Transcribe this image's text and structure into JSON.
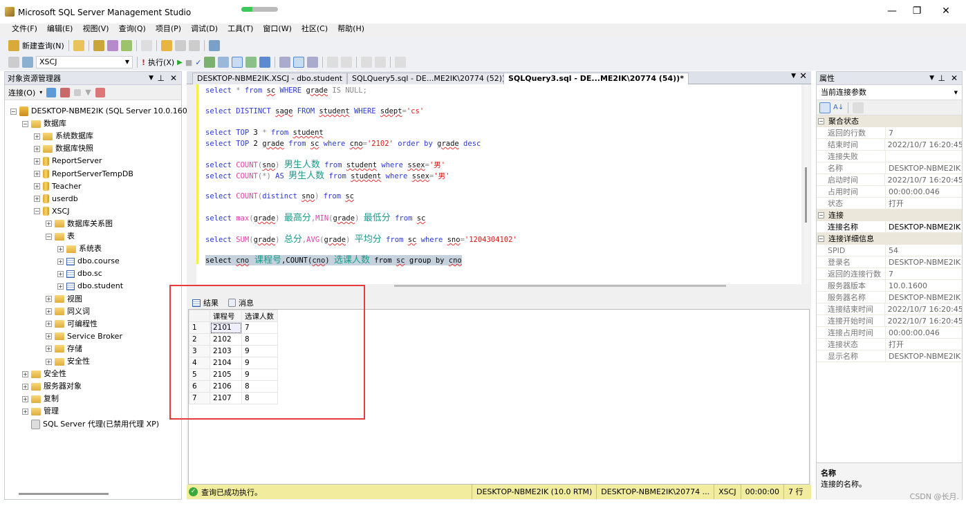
{
  "window": {
    "title": "Microsoft SQL Server Management Studio",
    "progress_percent": 30,
    "min": "—",
    "restore": "❐",
    "close": "✕"
  },
  "menu": [
    "文件(F)",
    "编辑(E)",
    "视图(V)",
    "查询(Q)",
    "项目(P)",
    "调试(D)",
    "工具(T)",
    "窗口(W)",
    "社区(C)",
    "帮助(H)"
  ],
  "toolbar1": {
    "new_query": "新建查询(N)"
  },
  "toolbar2": {
    "database": "XSCJ",
    "execute": "执行(X)"
  },
  "object_explorer": {
    "title": "对象资源管理器",
    "connect": "连接(O)",
    "items": [
      {
        "label": "DESKTOP-NBME2IK (SQL Server 10.0.1600",
        "icon": "server",
        "exp": "−",
        "level": 0
      },
      {
        "label": "数据库",
        "icon": "folder",
        "exp": "−",
        "level": 1
      },
      {
        "label": "系统数据库",
        "icon": "folder",
        "exp": "+",
        "level": 2
      },
      {
        "label": "数据库快照",
        "icon": "folder",
        "exp": "+",
        "level": 2
      },
      {
        "label": "ReportServer",
        "icon": "database",
        "exp": "+",
        "level": 2
      },
      {
        "label": "ReportServerTempDB",
        "icon": "database",
        "exp": "+",
        "level": 2
      },
      {
        "label": "Teacher",
        "icon": "database",
        "exp": "+",
        "level": 2
      },
      {
        "label": "userdb",
        "icon": "database",
        "exp": "+",
        "level": 2
      },
      {
        "label": "XSCJ",
        "icon": "database",
        "exp": "−",
        "level": 2
      },
      {
        "label": "数据库关系图",
        "icon": "folder",
        "exp": "+",
        "level": 3
      },
      {
        "label": "表",
        "icon": "folder",
        "exp": "−",
        "level": 3
      },
      {
        "label": "系统表",
        "icon": "folder",
        "exp": "+",
        "level": 4
      },
      {
        "label": "dbo.course",
        "icon": "table",
        "exp": "+",
        "level": 4
      },
      {
        "label": "dbo.sc",
        "icon": "table",
        "exp": "+",
        "level": 4
      },
      {
        "label": "dbo.student",
        "icon": "table",
        "exp": "+",
        "level": 4
      },
      {
        "label": "视图",
        "icon": "folder",
        "exp": "+",
        "level": 3
      },
      {
        "label": "同义词",
        "icon": "folder",
        "exp": "+",
        "level": 3
      },
      {
        "label": "可编程性",
        "icon": "folder",
        "exp": "+",
        "level": 3
      },
      {
        "label": "Service Broker",
        "icon": "folder",
        "exp": "+",
        "level": 3
      },
      {
        "label": "存储",
        "icon": "folder",
        "exp": "+",
        "level": 3
      },
      {
        "label": "安全性",
        "icon": "folder",
        "exp": "+",
        "level": 3
      },
      {
        "label": "安全性",
        "icon": "folder",
        "exp": "+",
        "level": 1
      },
      {
        "label": "服务器对象",
        "icon": "folder",
        "exp": "+",
        "level": 1
      },
      {
        "label": "复制",
        "icon": "folder",
        "exp": "+",
        "level": 1
      },
      {
        "label": "管理",
        "icon": "folder",
        "exp": "+",
        "level": 1
      },
      {
        "label": "SQL Server 代理(已禁用代理 XP)",
        "icon": "agent",
        "exp": "",
        "level": 1
      }
    ]
  },
  "tabs": [
    {
      "label": "DESKTOP-NBME2IK.XSCJ - dbo.student",
      "active": false
    },
    {
      "label": "SQLQuery5.sql - DE...ME2IK\\20774 (52))*",
      "active": false
    },
    {
      "label": "SQLQuery3.sql - DE...ME2IK\\20774 (54))*",
      "active": true
    }
  ],
  "editor": {
    "lines": [
      {
        "row": 0,
        "tokens": [
          [
            "kw",
            "select "
          ],
          [
            "gr",
            "* "
          ],
          [
            "kw",
            "from "
          ],
          [
            "id",
            "sc"
          ],
          [
            "kw",
            " WHERE "
          ],
          [
            "id",
            "grade"
          ],
          [
            "gr",
            " IS NULL;"
          ]
        ]
      },
      {
        "row": 2,
        "tokens": [
          [
            "kw",
            "select DISTINCT "
          ],
          [
            "id",
            "sage"
          ],
          [
            "kw",
            " FROM "
          ],
          [
            "id",
            "student"
          ],
          [
            "kw",
            " WHERE "
          ],
          [
            "id",
            "sdept"
          ],
          [
            "gr",
            "="
          ],
          [
            "str",
            "'cs'"
          ]
        ]
      },
      {
        "row": 4,
        "tokens": [
          [
            "kw",
            "select TOP "
          ],
          [
            "tx",
            "3 "
          ],
          [
            "gr",
            "* "
          ],
          [
            "kw",
            "from "
          ],
          [
            "id",
            "student"
          ]
        ]
      },
      {
        "row": 5,
        "tokens": [
          [
            "kw",
            "select TOP "
          ],
          [
            "tx",
            "2 "
          ],
          [
            "id",
            "grade"
          ],
          [
            "kw",
            " from "
          ],
          [
            "id",
            "sc"
          ],
          [
            "kw",
            " where "
          ],
          [
            "id",
            "cno"
          ],
          [
            "gr",
            "="
          ],
          [
            "str",
            "'2102'"
          ],
          [
            "kw",
            " order by "
          ],
          [
            "id",
            "grade"
          ],
          [
            "kw",
            " desc"
          ]
        ]
      },
      {
        "row": 7,
        "tokens": [
          [
            "kw",
            "select "
          ],
          [
            "fn",
            "COUNT"
          ],
          [
            "gr",
            "("
          ],
          [
            "id",
            "sno"
          ],
          [
            "gr",
            ") "
          ],
          [
            "al",
            "男生人数"
          ],
          [
            "kw",
            " from "
          ],
          [
            "id",
            "student"
          ],
          [
            "kw",
            " where "
          ],
          [
            "id",
            "ssex"
          ],
          [
            "gr",
            "="
          ],
          [
            "str",
            "'男'"
          ]
        ]
      },
      {
        "row": 8,
        "tokens": [
          [
            "kw",
            "select "
          ],
          [
            "fn",
            "COUNT"
          ],
          [
            "gr",
            "(*) "
          ],
          [
            "kw",
            "AS "
          ],
          [
            "al",
            "男生人数"
          ],
          [
            "kw",
            " from "
          ],
          [
            "id",
            "student"
          ],
          [
            "kw",
            " where "
          ],
          [
            "id",
            "ssex"
          ],
          [
            "gr",
            "="
          ],
          [
            "str",
            "'男'"
          ]
        ]
      },
      {
        "row": 10,
        "tokens": [
          [
            "kw",
            "select "
          ],
          [
            "fn",
            "COUNT"
          ],
          [
            "gr",
            "("
          ],
          [
            "kw",
            "distinct "
          ],
          [
            "id",
            "sno"
          ],
          [
            "gr",
            ") "
          ],
          [
            "kw",
            "from "
          ],
          [
            "id",
            "sc"
          ]
        ]
      },
      {
        "row": 12,
        "tokens": [
          [
            "kw",
            "select "
          ],
          [
            "fn",
            "max"
          ],
          [
            "gr",
            "("
          ],
          [
            "id",
            "grade"
          ],
          [
            "gr",
            ") "
          ],
          [
            "al",
            "最高分"
          ],
          [
            "gr",
            ","
          ],
          [
            "fn",
            "MIN"
          ],
          [
            "gr",
            "("
          ],
          [
            "id",
            "grade"
          ],
          [
            "gr",
            ") "
          ],
          [
            "al",
            "最低分"
          ],
          [
            "kw",
            " from "
          ],
          [
            "id",
            "sc"
          ]
        ]
      },
      {
        "row": 14,
        "tokens": [
          [
            "kw",
            "select "
          ],
          [
            "fn",
            "SUM"
          ],
          [
            "gr",
            "("
          ],
          [
            "id",
            "grade"
          ],
          [
            "gr",
            ") "
          ],
          [
            "al",
            "总分"
          ],
          [
            "gr",
            ","
          ],
          [
            "fn",
            "AVG"
          ],
          [
            "gr",
            "("
          ],
          [
            "id",
            "grade"
          ],
          [
            "gr",
            ") "
          ],
          [
            "al",
            "平均分"
          ],
          [
            "kw",
            " from "
          ],
          [
            "id",
            "sc"
          ],
          [
            "kw",
            " where "
          ],
          [
            "id",
            "sno"
          ],
          [
            "gr",
            "="
          ],
          [
            "str",
            "'1204304102'"
          ]
        ]
      },
      {
        "row": 16,
        "selected": true,
        "tokens": [
          [
            "tx",
            "select "
          ],
          [
            "id",
            "cno"
          ],
          [
            "al",
            " 课程号"
          ],
          [
            "tx",
            ",COUNT("
          ],
          [
            "id",
            "cno"
          ],
          [
            "tx",
            ") "
          ],
          [
            "al",
            "选课人数"
          ],
          [
            "tx",
            " from "
          ],
          [
            "id",
            "sc"
          ],
          [
            "tx",
            " group by "
          ],
          [
            "id",
            "cno"
          ]
        ]
      }
    ]
  },
  "results": {
    "tab_results": "结果",
    "tab_messages": "消息",
    "columns": [
      "课程号",
      "选课人数"
    ],
    "rows": [
      [
        "1",
        "2101",
        "7"
      ],
      [
        "2",
        "2102",
        "8"
      ],
      [
        "3",
        "2103",
        "9"
      ],
      [
        "4",
        "2104",
        "9"
      ],
      [
        "5",
        "2105",
        "9"
      ],
      [
        "6",
        "2106",
        "8"
      ],
      [
        "7",
        "2107",
        "8"
      ]
    ]
  },
  "status": {
    "message": "查询已成功执行。",
    "server": "DESKTOP-NBME2IK (10.0 RTM)",
    "user": "DESKTOP-NBME2IK\\20774 ...",
    "database": "XSCJ",
    "time": "00:00:00",
    "rows": "7 行"
  },
  "properties": {
    "title": "属性",
    "selector": "当前连接参数",
    "categories": [
      {
        "name": "聚合状态",
        "rows": [
          [
            "返回的行数",
            "7"
          ],
          [
            "结束时间",
            "2022/10/7 16:20:45"
          ],
          [
            "连接失败",
            ""
          ],
          [
            "名称",
            "DESKTOP-NBME2IK"
          ],
          [
            "启动时间",
            "2022/10/7 16:20:45"
          ],
          [
            "占用时间",
            "00:00:00.046"
          ],
          [
            "状态",
            "打开"
          ]
        ]
      },
      {
        "name": "连接",
        "bold": true,
        "rows": [
          [
            "连接名称",
            "DESKTOP-NBME2IK"
          ]
        ]
      },
      {
        "name": "连接详细信息",
        "rows": [
          [
            "SPID",
            "54"
          ],
          [
            "登录名",
            "DESKTOP-NBME2IK"
          ],
          [
            "返回的连接行数",
            "7"
          ],
          [
            "服务器版本",
            "10.0.1600"
          ],
          [
            "服务器名称",
            "DESKTOP-NBME2IK"
          ],
          [
            "连接结束时间",
            "2022/10/7 16:20:45"
          ],
          [
            "连接开始时间",
            "2022/10/7 16:20:45"
          ],
          [
            "连接占用时间",
            "00:00:00.046"
          ],
          [
            "连接状态",
            "打开"
          ],
          [
            "显示名称",
            "DESKTOP-NBME2IK"
          ]
        ]
      }
    ],
    "desc_title": "名称",
    "desc_text": "连接的名称。"
  },
  "watermark": "CSDN @长月."
}
